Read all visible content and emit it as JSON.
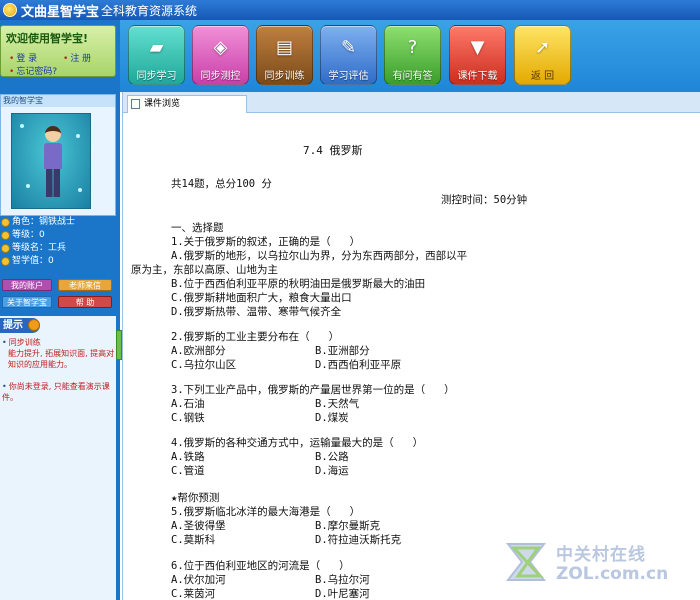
{
  "window": {
    "title_main": "文曲星智学宝",
    "title_sub": "全科教育资源系统"
  },
  "toolbar": {
    "buttons": [
      {
        "label": "同步学习",
        "icon": "book-icon"
      },
      {
        "label": "同步测控",
        "icon": "device-icon"
      },
      {
        "label": "同步训练",
        "icon": "books-icon"
      },
      {
        "label": "学习评估",
        "icon": "checklist-icon"
      },
      {
        "label": "有问有答",
        "icon": "question-person-icon"
      },
      {
        "label": "课件下载",
        "icon": "download-icon"
      },
      {
        "label": "返 回",
        "icon": "return-arrow-icon"
      }
    ]
  },
  "sidebar": {
    "welcome": "欢迎使用智学宝!",
    "login": "登 录",
    "register": "注 册",
    "forgot": "忘记密码?",
    "mascot_header": "我的智学宝",
    "stats": [
      "角色：钢铁战士",
      "等级：0",
      "等级名：工兵",
      "智学值：0"
    ],
    "btn_account": "我的账户",
    "btn_teacher": "老师来信",
    "btn_about": "关于智学宝",
    "btn_help": "帮 助",
    "tip_title": "提示",
    "tip_1": "同步训练",
    "tip_1_detail": "能力提升, 拓展知识面, 提高对知识的应用能力。",
    "tip_2": "你尚未登录, 只能查看演示课件。"
  },
  "content": {
    "tab_label": "课件浏览",
    "doc": {
      "title": "7.4 俄罗斯",
      "summary": "共14题，总分100 分",
      "time": "测控时间：50分钟",
      "lines": [
        "一、选择题",
        "1.关于俄罗斯的叙述，正确的是（   ）",
        "A.俄罗斯的地形，以乌拉尔山为界，分为东西两部分，西部以平",
        "原为主，东部以高原、山地为主",
        "B.位于西西伯利亚平原的秋明油田是俄罗斯最大的油田",
        "C.俄罗斯耕地面积广大，粮食大量出口",
        "D.俄罗斯热带、温带、寒带气候齐全",
        "2.俄罗斯的工业主要分布在（   ）",
        "A.欧洲部分",
        "B.亚洲部分",
        "C.乌拉尔山区",
        "D.西西伯利亚平原",
        "3.下列工业产品中，俄罗斯的产量居世界第一位的是（   ）",
        "A.石油",
        "B.天然气",
        "C.钢铁",
        "D.煤炭",
        "4.俄罗斯的各种交通方式中，运输量最大的是（   ）",
        "A.铁路",
        "B.公路",
        "C.管道",
        "D.海运",
        "★帮你预测",
        "5.俄罗斯临北冰洋的最大海港是（   ）",
        "A.圣彼得堡",
        "B.摩尔曼斯克",
        "C.莫斯科",
        "D.符拉迪沃斯托克",
        "6.位于西伯利亚地区的河流是（   ）",
        "A.伏尔加河",
        "B.乌拉尔河",
        "C.莱茵河",
        "D.叶尼塞河"
      ]
    }
  },
  "watermark": {
    "line1": "中关村在线",
    "line2": "ZOL.com.cn"
  }
}
